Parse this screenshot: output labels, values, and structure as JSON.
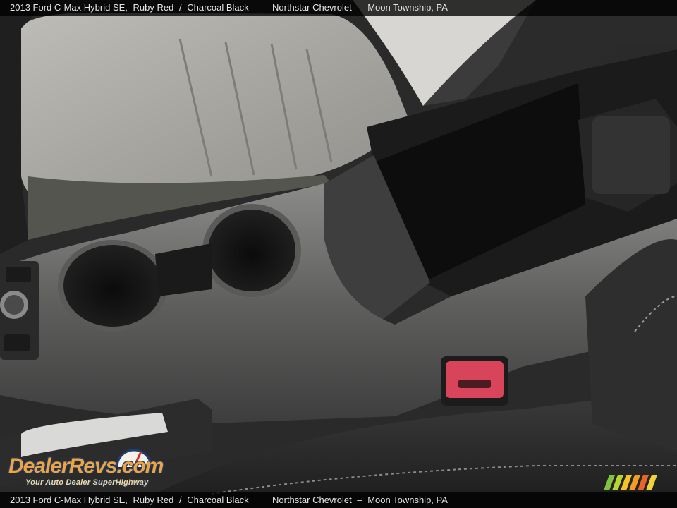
{
  "caption": {
    "vehicle": "2013 Ford C-Max Hybrid SE,",
    "exterior": "Ruby Red",
    "separator": "/",
    "interior": "Charcoal Black",
    "dealer": "Northstar Chevrolet",
    "dash": "–",
    "location": "Moon Township, PA"
  },
  "watermark": {
    "brand": "DealerRevs.com",
    "tagline": "Your Auto Dealer SuperHighway"
  },
  "colors": {
    "caption_bg": "#000000",
    "caption_text": "#e6e6e6",
    "brand_orange": "#f2a33a",
    "brand_blue": "#1d3f73",
    "buckle_red": "#d8455a"
  }
}
